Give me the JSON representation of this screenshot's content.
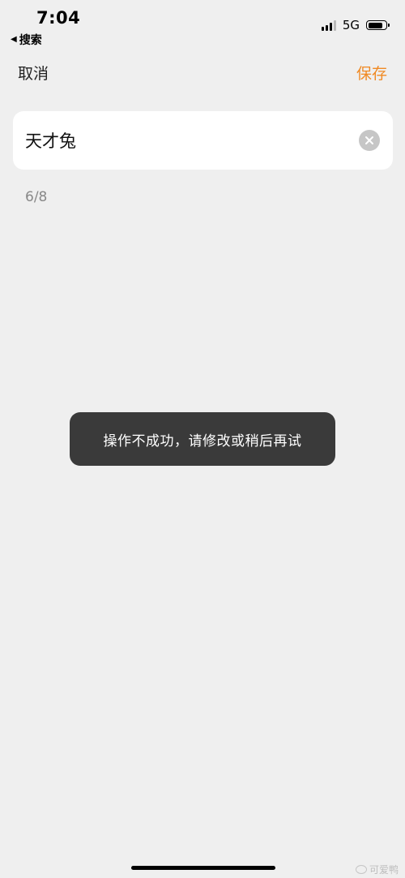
{
  "status_bar": {
    "time": "7:04",
    "back_app": "搜索",
    "network": "5G",
    "battery_level": 0.85
  },
  "nav": {
    "cancel_label": "取消",
    "save_label": "保存",
    "save_color": "#f08a24"
  },
  "name_input": {
    "value": "天才兔",
    "clear_icon": "clear-circle-icon"
  },
  "char_count": "6/8",
  "toast": {
    "message": "操作不成功，请修改或稍后再试"
  },
  "watermark": {
    "text": "可爱鸭"
  }
}
